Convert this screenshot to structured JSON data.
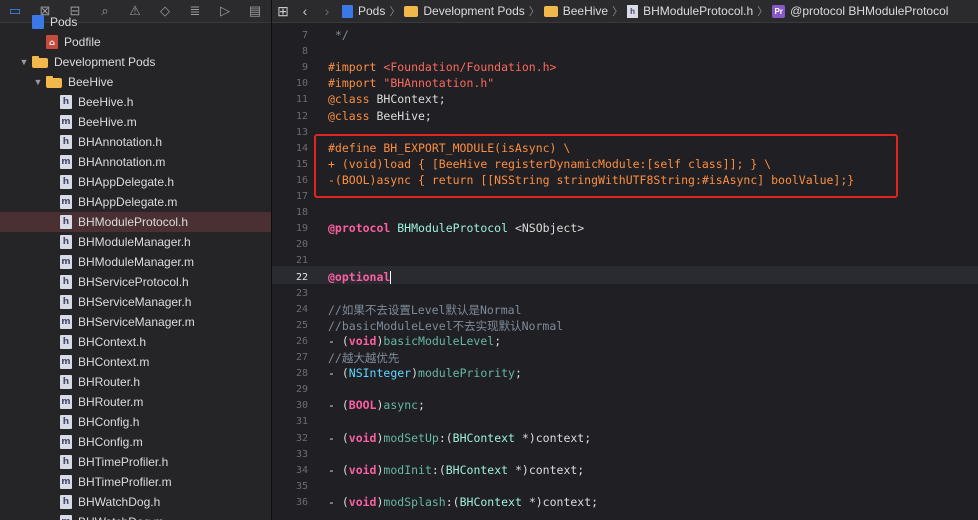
{
  "navigator": {
    "toolbar_icons": [
      "folder-icon",
      "source-control-icon",
      "symbol-icon",
      "find-icon",
      "issue-icon",
      "test-icon",
      "debug-icon",
      "breakpoint-icon",
      "report-icon"
    ],
    "items": [
      {
        "label": "Pods",
        "kind": "proj",
        "indent": 0,
        "disclosure": ""
      },
      {
        "label": "Podfile",
        "kind": "podfile",
        "indent": 1,
        "disclosure": ""
      },
      {
        "label": "Development Pods",
        "kind": "folder",
        "indent": 0,
        "disclosure": "▼"
      },
      {
        "label": "BeeHive",
        "kind": "folder",
        "indent": 1,
        "disclosure": "▼"
      },
      {
        "label": "BeeHive.h",
        "kind": "h",
        "indent": 2
      },
      {
        "label": "BeeHive.m",
        "kind": "m",
        "indent": 2
      },
      {
        "label": "BHAnnotation.h",
        "kind": "h",
        "indent": 2
      },
      {
        "label": "BHAnnotation.m",
        "kind": "m",
        "indent": 2
      },
      {
        "label": "BHAppDelegate.h",
        "kind": "h",
        "indent": 2
      },
      {
        "label": "BHAppDelegate.m",
        "kind": "m",
        "indent": 2
      },
      {
        "label": "BHModuleProtocol.h",
        "kind": "h",
        "indent": 2,
        "selected": true
      },
      {
        "label": "BHModuleManager.h",
        "kind": "h",
        "indent": 2
      },
      {
        "label": "BHModuleManager.m",
        "kind": "m",
        "indent": 2
      },
      {
        "label": "BHServiceProtocol.h",
        "kind": "h",
        "indent": 2
      },
      {
        "label": "BHServiceManager.h",
        "kind": "h",
        "indent": 2
      },
      {
        "label": "BHServiceManager.m",
        "kind": "m",
        "indent": 2
      },
      {
        "label": "BHContext.h",
        "kind": "h",
        "indent": 2
      },
      {
        "label": "BHContext.m",
        "kind": "m",
        "indent": 2
      },
      {
        "label": "BHRouter.h",
        "kind": "h",
        "indent": 2
      },
      {
        "label": "BHRouter.m",
        "kind": "m",
        "indent": 2
      },
      {
        "label": "BHConfig.h",
        "kind": "h",
        "indent": 2
      },
      {
        "label": "BHConfig.m",
        "kind": "m",
        "indent": 2
      },
      {
        "label": "BHTimeProfiler.h",
        "kind": "h",
        "indent": 2
      },
      {
        "label": "BHTimeProfiler.m",
        "kind": "m",
        "indent": 2
      },
      {
        "label": "BHWatchDog.h",
        "kind": "h",
        "indent": 2
      },
      {
        "label": "BHWatchDog.m",
        "kind": "m",
        "indent": 2
      }
    ]
  },
  "jumpbar": {
    "crumbs": [
      {
        "label": "Pods",
        "icon": "proj"
      },
      {
        "label": "Development Pods",
        "icon": "folder"
      },
      {
        "label": "BeeHive",
        "icon": "folder"
      },
      {
        "label": "BHModuleProtocol.h",
        "icon": "h"
      },
      {
        "label": "@protocol BHModuleProtocol",
        "icon": "pr"
      }
    ]
  },
  "editor": {
    "current_line": 22,
    "highlight_lines": [
      14,
      16
    ],
    "lines": [
      {
        "n": 7,
        "tokens": [
          [
            "comment",
            " */"
          ]
        ]
      },
      {
        "n": 8,
        "tokens": []
      },
      {
        "n": 9,
        "tokens": [
          [
            "pre",
            "#import "
          ],
          [
            "str",
            "<Foundation/Foundation.h>"
          ]
        ]
      },
      {
        "n": 10,
        "tokens": [
          [
            "pre",
            "#import "
          ],
          [
            "str",
            "\"BHAnnotation.h\""
          ]
        ]
      },
      {
        "n": 11,
        "tokens": [
          [
            "pre",
            "@class "
          ],
          [
            "plain",
            "BHContext;"
          ]
        ]
      },
      {
        "n": 12,
        "tokens": [
          [
            "pre",
            "@class "
          ],
          [
            "plain",
            "BeeHive;"
          ]
        ]
      },
      {
        "n": 13,
        "tokens": []
      },
      {
        "n": 14,
        "tokens": [
          [
            "pre",
            "#define BH_EXPORT_MODULE(isAsync) \\"
          ]
        ]
      },
      {
        "n": 15,
        "tokens": [
          [
            "pre",
            "+ (void)load { [BeeHive registerDynamicModule:[self class]]; } \\"
          ]
        ]
      },
      {
        "n": 16,
        "tokens": [
          [
            "pre",
            "-(BOOL)async { return [[NSString stringWithUTF8String:#isAsync] boolValue];}"
          ]
        ]
      },
      {
        "n": 17,
        "tokens": []
      },
      {
        "n": 18,
        "tokens": []
      },
      {
        "n": 19,
        "tokens": [
          [
            "kw",
            "@protocol "
          ],
          [
            "class",
            "BHModuleProtocol "
          ],
          [
            "plain",
            "<NSObject>"
          ]
        ]
      },
      {
        "n": 20,
        "tokens": []
      },
      {
        "n": 21,
        "tokens": []
      },
      {
        "n": 22,
        "tokens": [
          [
            "kw",
            "@optional"
          ]
        ],
        "caret": true
      },
      {
        "n": 23,
        "tokens": []
      },
      {
        "n": 24,
        "tokens": [
          [
            "comment",
            "//如果不去设置Level默认是Normal"
          ]
        ]
      },
      {
        "n": 25,
        "tokens": [
          [
            "comment",
            "//basicModuleLevel不去实现默认Normal"
          ]
        ]
      },
      {
        "n": 26,
        "tokens": [
          [
            "plain",
            "- ("
          ],
          [
            "kw",
            "void"
          ],
          [
            "plain",
            ")"
          ],
          [
            "method",
            "basicModuleLevel"
          ],
          [
            "plain",
            ";"
          ]
        ]
      },
      {
        "n": 27,
        "tokens": [
          [
            "comment",
            "//越大越优先"
          ]
        ]
      },
      {
        "n": 28,
        "tokens": [
          [
            "plain",
            "- ("
          ],
          [
            "type",
            "NSInteger"
          ],
          [
            "plain",
            ")"
          ],
          [
            "method",
            "modulePriority"
          ],
          [
            "plain",
            ";"
          ]
        ]
      },
      {
        "n": 29,
        "tokens": []
      },
      {
        "n": 30,
        "tokens": [
          [
            "plain",
            "- ("
          ],
          [
            "kw",
            "BOOL"
          ],
          [
            "plain",
            ")"
          ],
          [
            "method",
            "async"
          ],
          [
            "plain",
            ";"
          ]
        ]
      },
      {
        "n": 31,
        "tokens": []
      },
      {
        "n": 32,
        "tokens": [
          [
            "plain",
            "- ("
          ],
          [
            "kw",
            "void"
          ],
          [
            "plain",
            ")"
          ],
          [
            "method",
            "modSetUp"
          ],
          [
            "plain",
            ":("
          ],
          [
            "class",
            "BHContext"
          ],
          [
            "plain",
            " *)context;"
          ]
        ]
      },
      {
        "n": 33,
        "tokens": []
      },
      {
        "n": 34,
        "tokens": [
          [
            "plain",
            "- ("
          ],
          [
            "kw",
            "void"
          ],
          [
            "plain",
            ")"
          ],
          [
            "method",
            "modInit"
          ],
          [
            "plain",
            ":("
          ],
          [
            "class",
            "BHContext"
          ],
          [
            "plain",
            " *)context;"
          ]
        ]
      },
      {
        "n": 35,
        "tokens": []
      },
      {
        "n": 36,
        "tokens": [
          [
            "plain",
            "- ("
          ],
          [
            "kw",
            "void"
          ],
          [
            "plain",
            ")"
          ],
          [
            "method",
            "modSplash"
          ],
          [
            "plain",
            ":("
          ],
          [
            "class",
            "BHContext"
          ],
          [
            "plain",
            " *)context;"
          ]
        ]
      }
    ]
  }
}
